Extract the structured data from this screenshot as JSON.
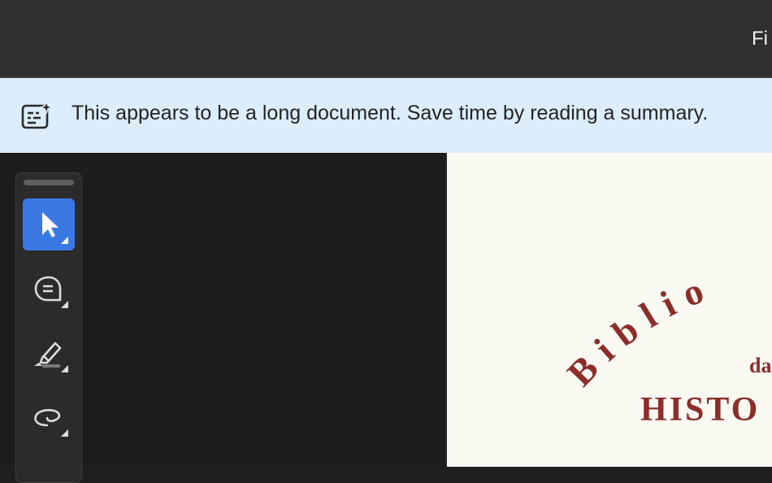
{
  "header": {
    "partial_text": "Fi"
  },
  "banner": {
    "icon": "ai-summary-icon",
    "text": "This appears to be a long document. Save time by reading a summary."
  },
  "toolbar": {
    "tools": [
      {
        "name": "select-tool",
        "icon": "cursor-arrow-icon",
        "active": true
      },
      {
        "name": "comment-tool",
        "icon": "comment-bubble-icon",
        "active": false
      },
      {
        "name": "highlight-tool",
        "icon": "highlighter-icon",
        "active": false
      },
      {
        "name": "draw-tool",
        "icon": "freehand-lasso-icon",
        "active": false
      }
    ]
  },
  "document": {
    "arc_title": "Biblio",
    "subtitle": "da",
    "main_title": "HISTO",
    "text_color": "#8b2e2a"
  },
  "colors": {
    "accent": "#3a78e2",
    "banner_bg": "#dceefc",
    "toolbar_bg": "#2b2b2b"
  }
}
